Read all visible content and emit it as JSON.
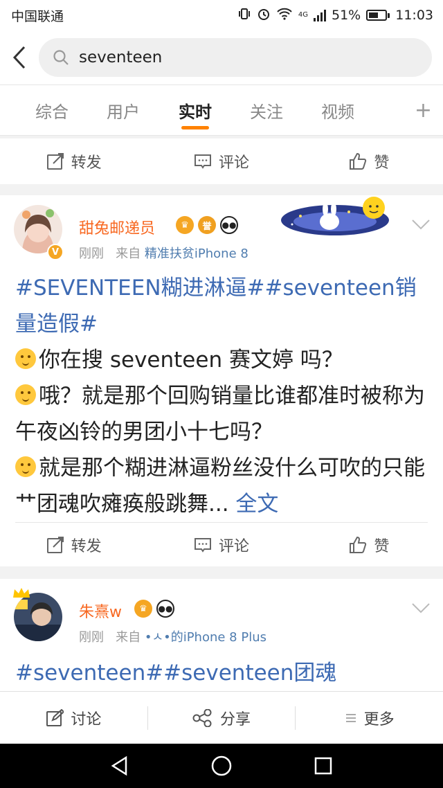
{
  "status_bar": {
    "carrier": "中国联通",
    "network": "4G",
    "battery": "51%",
    "time": "11:03"
  },
  "search": {
    "query": "seventeen",
    "back_icon": "chevron-left-icon",
    "search_icon": "magnifier-icon"
  },
  "tabs": [
    {
      "label": "综合"
    },
    {
      "label": "用户"
    },
    {
      "label": "实时",
      "active": true
    },
    {
      "label": "关注"
    },
    {
      "label": "视频"
    }
  ],
  "tab_add": "+",
  "actions": {
    "repost": "转发",
    "comment": "评论",
    "like": "赞"
  },
  "posts": [
    {
      "username": "甜兔邮递员",
      "time": "刚刚",
      "from_label": "来自",
      "source": "精准扶贫iPhone 8",
      "tag": "#SEVENTEEN糊进淋逼##seventeen销量造假#",
      "line1": "你在搜 seventeen 赛文婷 吗？",
      "line2": "哦？就是那个回购销量比谁都准时被称为午夜凶铃的男团小十七吗？",
      "line3": "就是那个糊进淋逼粉丝没什么可吹的只能艹团魂吹瘫痪般跳舞...",
      "more": "全文"
    },
    {
      "username": "朱熹w",
      "time": "刚刚",
      "from_label": "来自",
      "source": "•ㅅ•的iPhone 8 Plus",
      "tag": "#seventeen##seventeen团魂"
    }
  ],
  "bottom_toolbar": {
    "discuss": "讨论",
    "share": "分享",
    "more": "更多"
  },
  "colors": {
    "accent": "#ff8200",
    "username": "#f86821",
    "link": "#3d6ab3",
    "meta": "#999999"
  }
}
